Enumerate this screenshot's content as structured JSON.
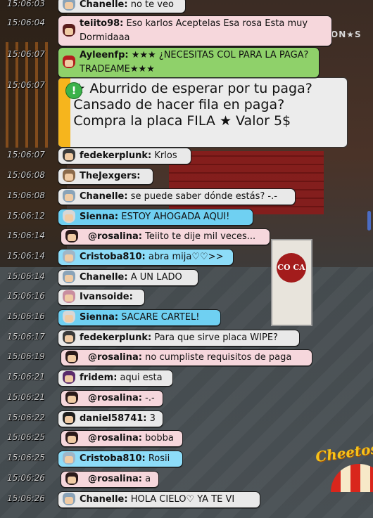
{
  "scene": {
    "banner_text": "CO CA",
    "brand_sign": "Cheetos",
    "neon_sign": "ON★S"
  },
  "notice": {
    "icon": "exclamation-icon",
    "timestamp": "15:06:07",
    "text": "★ Aburrido de esperar por tu paga? Cansado de hacer fila en paga? Compra la placa FILA ★ Valor 5$"
  },
  "messages": [
    {
      "time": "15:06:03",
      "user": "Chanelle:",
      "text": " no te veo",
      "color": "white",
      "hair": "#8aa3b8"
    },
    {
      "time": "15:06:04",
      "user": "teiito98:",
      "text": " Eso karlos Aceptelas Esa rosa Esta muy Dormidaaa",
      "color": "pink",
      "hair": "#5b1d1d"
    },
    {
      "time": "15:06:07",
      "user": "Ayleenfp:",
      "text": " ★★★ ¿NECESITAS COL PARA LA PAGA? TRADEAME★★★",
      "color": "green",
      "hair": "#b31d1d"
    },
    {
      "time": "15:06:07",
      "user": "fedekerplunk:",
      "text": " Krlos",
      "color": "white",
      "hair": "#3a3a3a"
    },
    {
      "time": "15:06:08",
      "user": "TheJexgers:",
      "text": "",
      "color": "white",
      "hair": "#8b6a4a"
    },
    {
      "time": "15:06:08",
      "user": "Chanelle:",
      "text": " se puede saber dónde estás? -.-",
      "color": "white",
      "hair": "#8aa3b8"
    },
    {
      "time": "15:06:12",
      "user": "Sienna:",
      "text": " ESTOY AHOGADA AQUI!",
      "color": "blue",
      "hair": "#d7d7d7"
    },
    {
      "time": "15:06:14",
      "user": "@rosalina:",
      "text": " Teiito te dije mil veces...",
      "color": "pink",
      "hair": "#2a1a1a"
    },
    {
      "time": "15:06:14",
      "user": "Cristoba810:",
      "text": " abra mija♡♡>>",
      "color": "lightblue",
      "hair": "#9fb6c8"
    },
    {
      "time": "15:06:14",
      "user": "Chanelle:",
      "text": " A UN LADO",
      "color": "white",
      "hair": "#8aa3b8"
    },
    {
      "time": "15:06:16",
      "user": "Ivansoide:",
      "text": "",
      "color": "white",
      "hair": "#c98ea0"
    },
    {
      "time": "15:06:16",
      "user": "Sienna:",
      "text": " SACARE CARTEL!",
      "color": "blue",
      "hair": "#d7d7d7"
    },
    {
      "time": "15:06:17",
      "user": "fedekerplunk:",
      "text": " Para que sirve placa WIPE?",
      "color": "white",
      "hair": "#3a3a3a"
    },
    {
      "time": "15:06:19",
      "user": "@rosalina:",
      "text": " no cumpliste requisitos de paga",
      "color": "pink",
      "hair": "#2a1a1a"
    },
    {
      "time": "15:06:21",
      "user": "fridem:",
      "text": " aqui esta",
      "color": "white",
      "hair": "#5a2b6b"
    },
    {
      "time": "15:06:21",
      "user": "@rosalina:",
      "text": " -.-",
      "color": "pink",
      "hair": "#2a1a1a"
    },
    {
      "time": "15:06:22",
      "user": "daniel58741:",
      "text": " 3",
      "color": "white",
      "hair": "#1e1e1e"
    },
    {
      "time": "15:06:25",
      "user": "@rosalina:",
      "text": " bobba",
      "color": "pink",
      "hair": "#2a1a1a"
    },
    {
      "time": "15:06:25",
      "user": "Cristoba810:",
      "text": " Rosii",
      "color": "lightblue",
      "hair": "#9fb6c8"
    },
    {
      "time": "15:06:26",
      "user": "@rosalina:",
      "text": " a",
      "color": "pink",
      "hair": "#2a1a1a"
    },
    {
      "time": "15:06:26",
      "user": "Chanelle:",
      "text": " HOLA CIELO♡ YA TE VI",
      "color": "white",
      "hair": "#8aa3b8"
    }
  ],
  "colors": {
    "white": "#e9e9e9",
    "pink": "#f6d7dc",
    "green": "#8fd16a",
    "blue": "#6fd0f2",
    "lightblue": "#8ddcf8",
    "notice_bar": "#f6b51d"
  }
}
